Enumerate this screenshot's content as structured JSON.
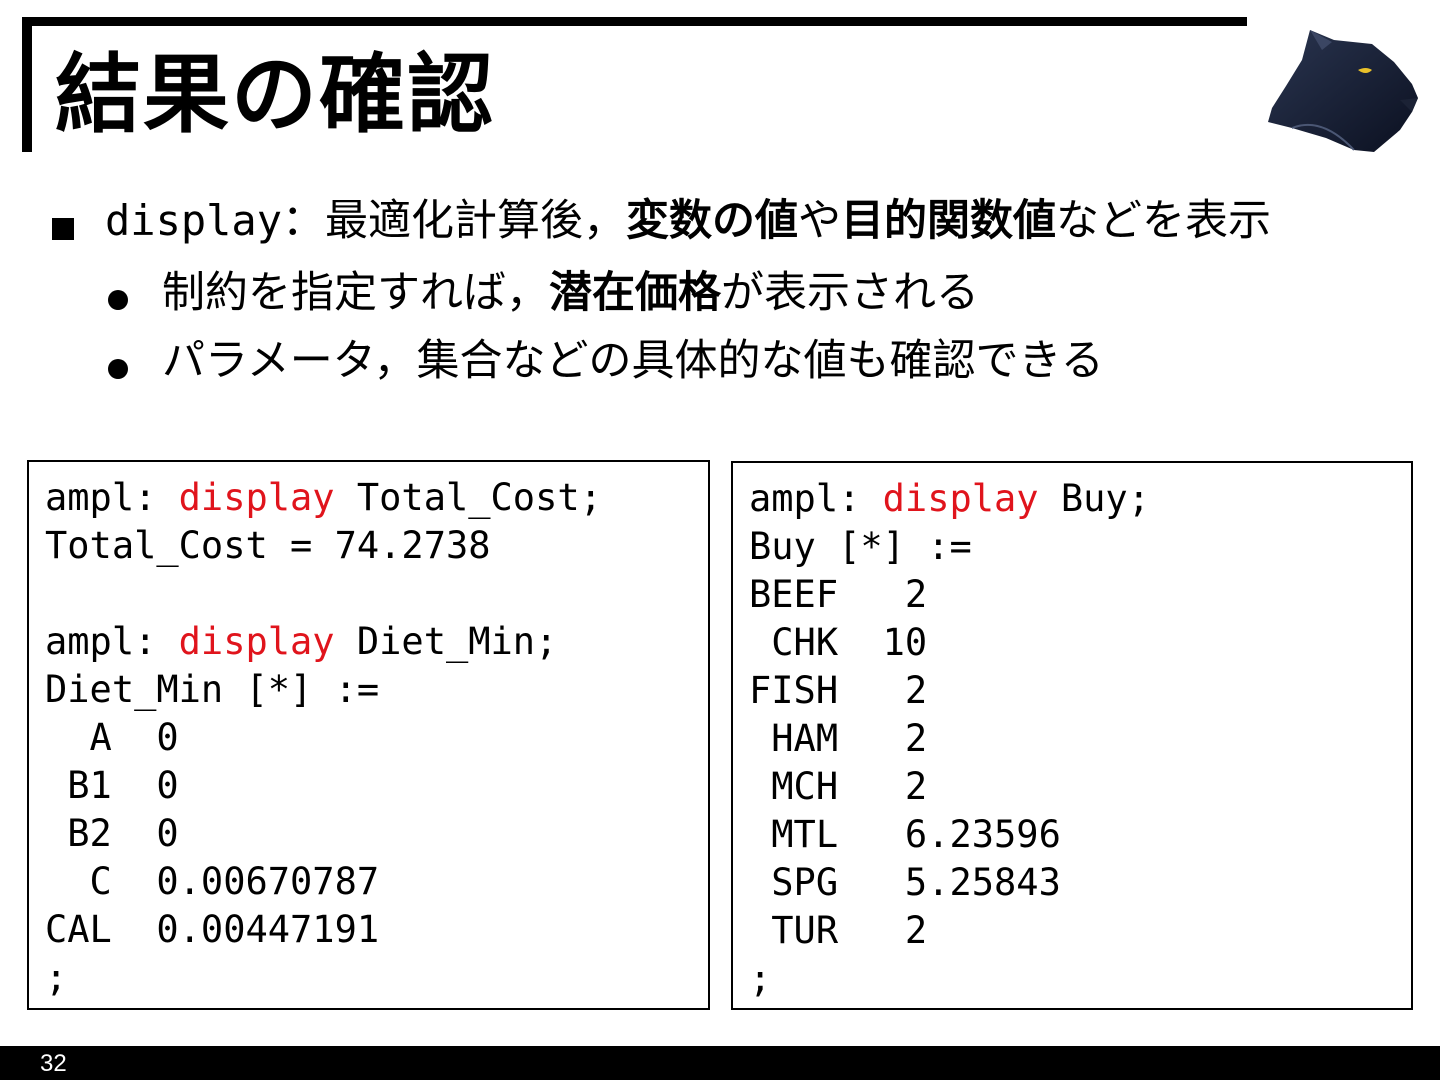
{
  "slide": {
    "title": "結果の確認",
    "page_number": "32"
  },
  "bullet1": {
    "code": "display",
    "sep": "：",
    "text_a": "最適化計算後，",
    "bold_a": "変数の値",
    "text_b": "や",
    "bold_b": "目的関数値",
    "text_c": "などを表示"
  },
  "bullet2": {
    "text_a": "制約を指定すれば，",
    "bold": "潜在価格",
    "text_b": "が表示される"
  },
  "bullet3": {
    "text": "パラメータ，集合などの具体的な値も確認できる"
  },
  "left_code": {
    "l1_prompt": "ampl: ",
    "l1_kw": "display",
    "l1_rest": " Total_Cost;",
    "l2": "Total_Cost = 74.2738",
    "l3": "",
    "l4_prompt": "ampl: ",
    "l4_kw": "display",
    "l4_rest": " Diet_Min;",
    "l5": "Diet_Min [*] :=",
    "l6": "  A  0",
    "l7": " B1  0",
    "l8": " B2  0",
    "l9": "  C  0.00670787",
    "l10": "CAL  0.00447191",
    "l11": ";"
  },
  "right_code": {
    "l1_prompt": "ampl: ",
    "l1_kw": "display",
    "l1_rest": " Buy;",
    "l2": "Buy [*] :=",
    "l3": "BEEF   2",
    "l4": " CHK  10",
    "l5": "FISH   2",
    "l6": " HAM   2",
    "l7": " MCH   2",
    "l8": " MTL   6.23596",
    "l9": " SPG   5.25843",
    "l10": " TUR   2",
    "l11": ";"
  },
  "colors": {
    "keyword": "#e0141c",
    "footer": "#000000"
  },
  "icons": {
    "logo": "panther-head-icon"
  }
}
